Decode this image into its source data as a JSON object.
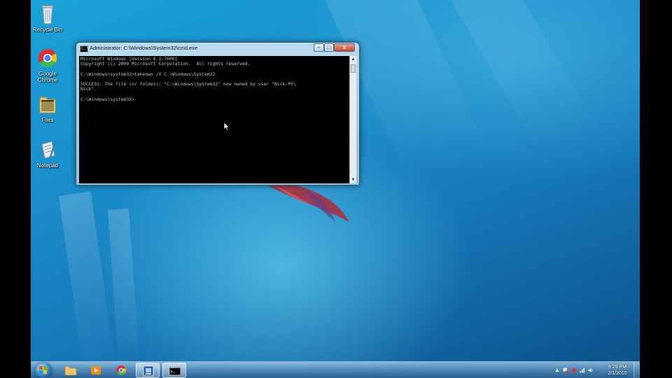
{
  "desktop": {
    "icons": [
      {
        "label": "Recycle Bin",
        "icon": "recycle-bin-icon"
      },
      {
        "label": "Google Chrome",
        "icon": "chrome-icon"
      },
      {
        "label": "Files",
        "icon": "folder-icon"
      },
      {
        "label": "Notepad",
        "icon": "notepad-icon"
      }
    ]
  },
  "cmd_window": {
    "title": "Administrator: C:\\Windows\\System32\\cmd.exe",
    "title_icon_text": "C:\\",
    "buttons": {
      "minimize": "–",
      "maximize": "□",
      "close": "x"
    },
    "console_text": "Microsoft Windows [Version 6.1.7600]\nCopyright (c) 2009 Microsoft Corporation.  All rights reserved.\n\nC:\\Windows\\system32>takeown /f C:\\Windows\\System32\n\nSUCCESS: The file (or folder): \"C:\\Windows\\System32\" now owned by user \"Nick-PC\\\nNick\".\n\nC:\\Windows\\system32>"
  },
  "taskbar": {
    "pinned": [
      {
        "name": "explorer",
        "icon": "folder-icon"
      },
      {
        "name": "media-player",
        "icon": "media-player-icon"
      },
      {
        "name": "chrome",
        "icon": "chrome-icon"
      },
      {
        "name": "control-panel",
        "icon": "control-panel-icon",
        "active": true
      },
      {
        "name": "cmd",
        "icon": "cmd-icon",
        "active": true
      }
    ],
    "tray": {
      "show_hidden": "▲",
      "time": "8:29 PM",
      "date": "2/1/2010"
    }
  },
  "colors": {
    "wallpaper": "#1b8cc9",
    "console_bg": "#000000",
    "console_fg": "#c8c8c8"
  }
}
